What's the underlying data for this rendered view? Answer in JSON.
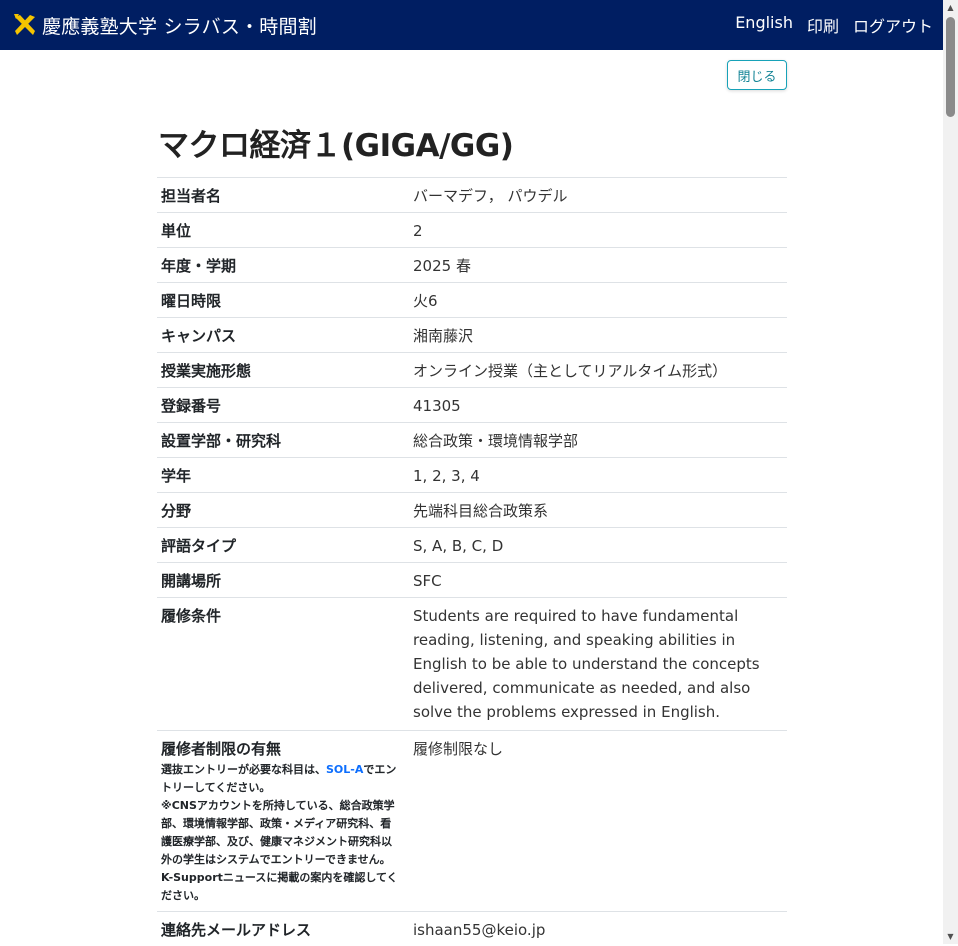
{
  "header": {
    "brand": "慶應義塾大学 シラバス・時間割",
    "links": [
      "English",
      "印刷",
      "ログアウト"
    ]
  },
  "close_label": "閉じる",
  "course": {
    "title": "マクロ経済１(GIGA/GG)",
    "rows": [
      {
        "label": "担当者名",
        "value": "バーマデフ， パウデル"
      },
      {
        "label": "単位",
        "value": "2"
      },
      {
        "label": "年度・学期",
        "value": "2025 春"
      },
      {
        "label": "曜日時限",
        "value": "火6"
      },
      {
        "label": "キャンパス",
        "value": "湘南藤沢"
      },
      {
        "label": "授業実施形態",
        "value": "オンライン授業（主としてリアルタイム形式）"
      },
      {
        "label": "登録番号",
        "value": "41305"
      },
      {
        "label": "設置学部・研究科",
        "value": "総合政策・環境情報学部"
      },
      {
        "label": "学年",
        "value": "1, 2, 3, 4"
      },
      {
        "label": "分野",
        "value": "先端科目総合政策系"
      },
      {
        "label": "評語タイプ",
        "value": "S, A, B, C, D"
      },
      {
        "label": "開講場所",
        "value": "SFC"
      },
      {
        "label": "履修条件",
        "value": "Students are required to have fundamental reading, listening, and speaking abilities in English to be able to understand the concepts delivered, communicate as needed, and also solve the problems expressed in English."
      },
      {
        "label": "履修者制限の有無",
        "value": "履修制限なし",
        "note_pre": "選抜エントリーが必要な科目は、",
        "note_link": "SOL-A",
        "note_post": "でエントリーしてください。",
        "note_2": "※CNSアカウントを所持している、総合政策学部、環境情報学部、政策・メディア研究科、看護医療学部、及び、健康マネジメント研究科以外の学生はシステムでエントリーできません。",
        "note_3": "K-Supportニュースに掲載の案内を確認してください。"
      },
      {
        "label": "連絡先メールアドレス",
        "value": "ishaan55@keio.jp"
      }
    ]
  }
}
